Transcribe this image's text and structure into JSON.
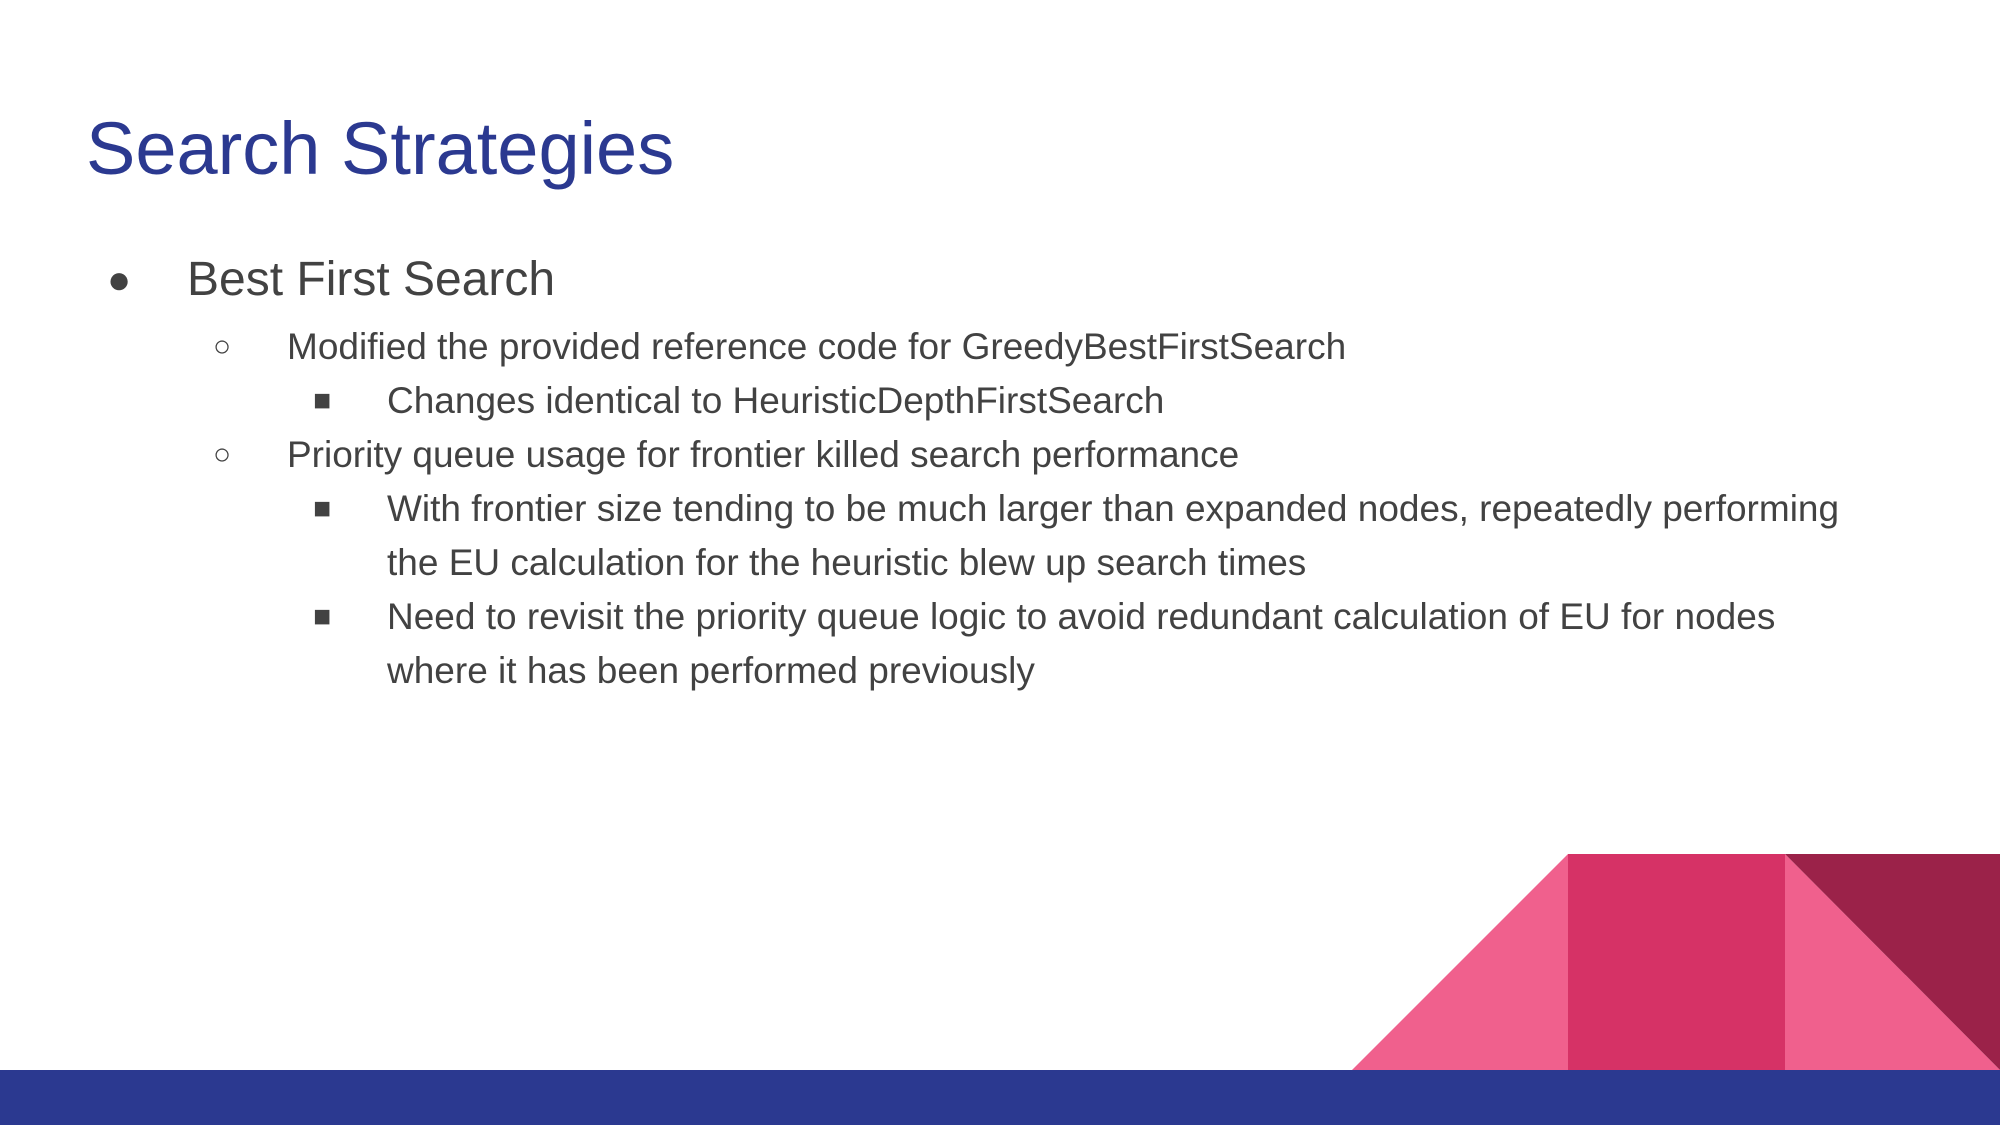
{
  "slide": {
    "title": "Search Strategies",
    "bullets": [
      {
        "marker": "●",
        "text": "Best First Search"
      },
      {
        "marker": "○",
        "text": "Modified the provided reference code for GreedyBestFirstSearch"
      },
      {
        "marker": "■",
        "text": "Changes identical to HeuristicDepthFirstSearch"
      },
      {
        "marker": "○",
        "text": "Priority queue usage for frontier killed search performance"
      },
      {
        "marker": "■",
        "line1": "With frontier size tending to be much larger than expanded nodes, repeatedly performing",
        "line2": "the EU calculation for the heuristic blew up search times"
      },
      {
        "marker": "■",
        "line1": "Need to revisit the priority queue logic to avoid redundant calculation of EU for nodes",
        "line2": "where it has been performed previously"
      }
    ]
  },
  "colors": {
    "title": "#2b3990",
    "text": "#424242",
    "footer_bar": "#2b3990",
    "pink_light": "#f0608d",
    "pink_mid": "#d63266",
    "maroon": "#9b2249"
  }
}
